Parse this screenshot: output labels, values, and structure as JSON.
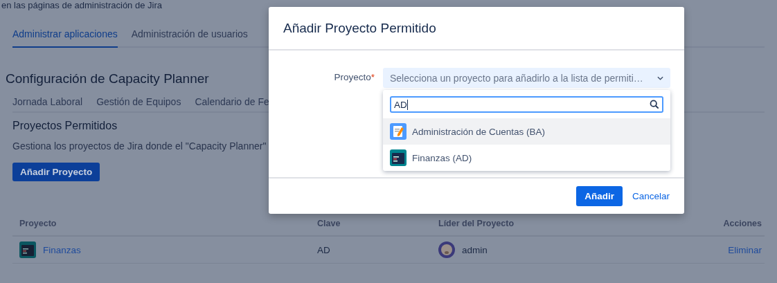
{
  "page": {
    "breadcrumb_text": "en las páginas de administración de Jira",
    "tabs": [
      {
        "label": "Administrar aplicaciones",
        "selected": true
      },
      {
        "label": "Administración de usuarios",
        "selected": false
      }
    ],
    "title": "Configuración de Capacity Planner",
    "subtabs": [
      {
        "label": "Jornada Laboral"
      },
      {
        "label": "Gestión de Equipos"
      },
      {
        "label": "Calendario de Fe"
      }
    ],
    "section_title": "Proyectos Permitidos",
    "description": "Gestiona los proyectos de Jira donde el \"Capacity Planner\"",
    "add_button": "Añadir Proyecto",
    "table": {
      "columns": [
        "Proyecto",
        "Clave",
        "Líder del Proyecto",
        "Acciones"
      ],
      "rows": [
        {
          "project": "Finanzas",
          "key": "AD",
          "lead": "admin",
          "action": "Eliminar"
        }
      ]
    }
  },
  "dialog": {
    "title": "Añadir Proyecto Permitido",
    "field_label": "Proyecto",
    "required_mark": "*",
    "select_placeholder": "Selecciona un proyecto para añadirlo a la lista de permiti…",
    "search_value": "AD",
    "options": [
      {
        "label": "Administración de Cuentas (BA)",
        "kind": "notebook",
        "selected": true
      },
      {
        "label": "Finanzas (AD)",
        "kind": "code",
        "selected": false
      }
    ],
    "buttons": [
      {
        "label": "Añadir",
        "kind": "primary"
      },
      {
        "label": "Cancelar",
        "kind": "link"
      }
    ]
  }
}
